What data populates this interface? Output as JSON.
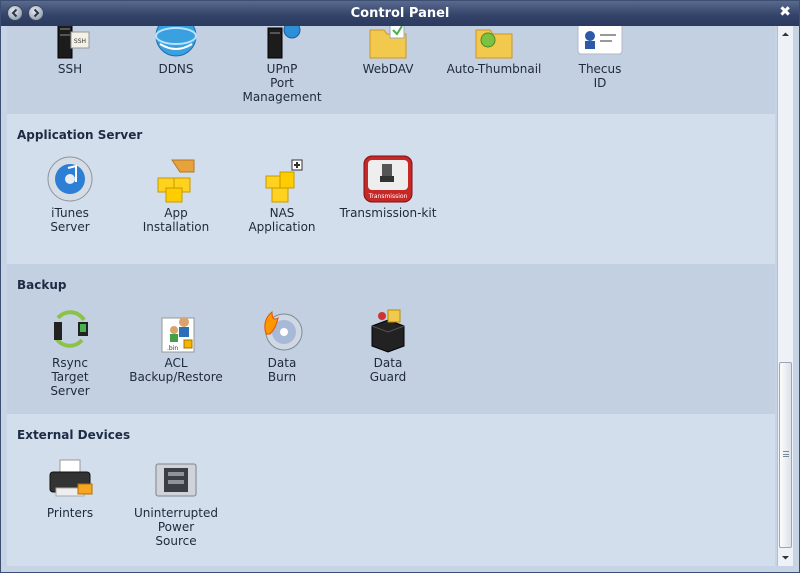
{
  "window": {
    "title": "Control Panel",
    "back_icon": "back-arrow-icon",
    "forward_icon": "forward-arrow-icon",
    "close_label": "✖"
  },
  "sections": {
    "network": {
      "items": [
        {
          "name": "ssh",
          "lines": [
            "SSH"
          ]
        },
        {
          "name": "ddns",
          "lines": [
            "DDNS"
          ]
        },
        {
          "name": "upnp",
          "lines": [
            "UPnP",
            "Port",
            "Management"
          ]
        },
        {
          "name": "webdav",
          "lines": [
            "WebDAV"
          ]
        },
        {
          "name": "auto-thumbnail",
          "lines": [
            "Auto-Thumbnail"
          ]
        },
        {
          "name": "thecus-id",
          "lines": [
            "Thecus",
            "ID"
          ]
        }
      ]
    },
    "application_server": {
      "title": "Application Server",
      "items": [
        {
          "name": "itunes-server",
          "lines": [
            "iTunes",
            "Server"
          ]
        },
        {
          "name": "app-installation",
          "lines": [
            "App",
            "Installation"
          ]
        },
        {
          "name": "nas-application",
          "lines": [
            "NAS",
            "Application"
          ]
        },
        {
          "name": "transmission-kit",
          "lines": [
            "Transmission-kit"
          ],
          "badge": "Transmission"
        }
      ]
    },
    "backup": {
      "title": "Backup",
      "items": [
        {
          "name": "rsync-target-server",
          "lines": [
            "Rsync",
            "Target",
            "Server"
          ]
        },
        {
          "name": "acl-backup-restore",
          "lines": [
            "ACL",
            "Backup/Restore"
          ],
          "badge": ".bin"
        },
        {
          "name": "data-burn",
          "lines": [
            "Data",
            "Burn"
          ]
        },
        {
          "name": "data-guard",
          "lines": [
            "Data",
            "Guard"
          ]
        }
      ]
    },
    "external_devices": {
      "title": "External Devices",
      "items": [
        {
          "name": "printers",
          "lines": [
            "Printers"
          ]
        },
        {
          "name": "ups",
          "lines": [
            "Uninterrupted",
            "Power",
            "Source"
          ]
        }
      ]
    }
  },
  "icons": {
    "ssh": "server-ssh-icon",
    "ssh_badge": "SSH",
    "colors": {
      "titlebar": "#34446a",
      "section_light": "#d3deed",
      "section_alt": "#c3d0e2"
    }
  }
}
